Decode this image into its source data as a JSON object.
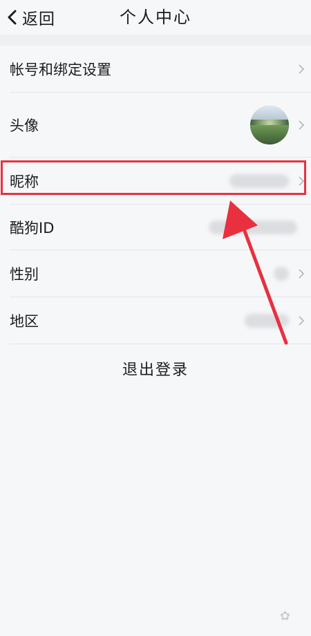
{
  "nav": {
    "back_label": "返回",
    "title": "个人中心"
  },
  "rows": [
    {
      "label": "帐号和绑定设置"
    },
    {
      "label": "头像"
    },
    {
      "label": "昵称"
    },
    {
      "label": "酷狗ID"
    },
    {
      "label": "性别"
    },
    {
      "label": "地区"
    }
  ],
  "logout_label": "退出登录",
  "colors": {
    "highlight": "#e8303e",
    "background": "#f6f7f9"
  }
}
